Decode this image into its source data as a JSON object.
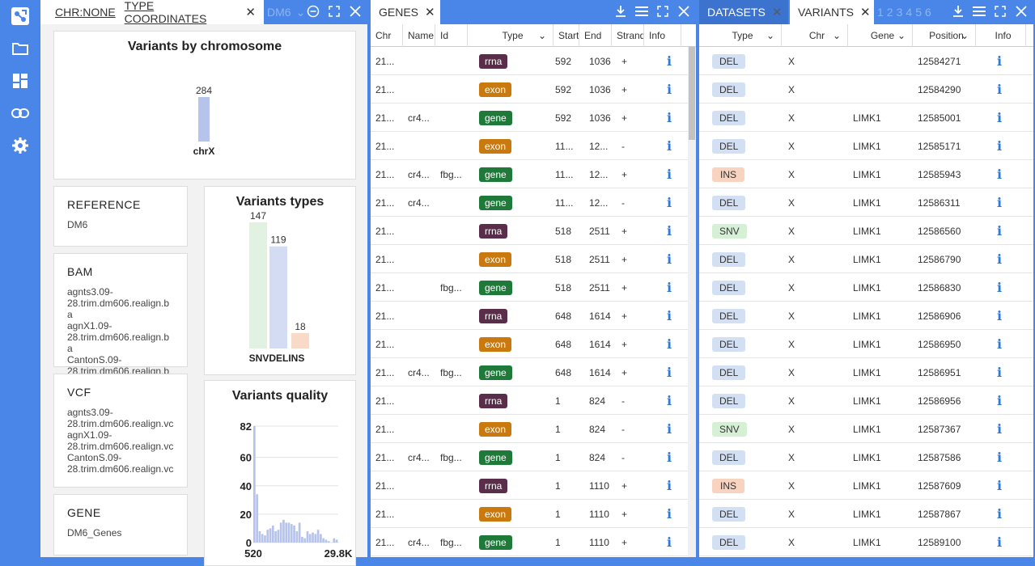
{
  "sidebar": {
    "items": [
      "logo-icon",
      "folder-icon",
      "dashboard-icon",
      "link-icon",
      "gear-icon"
    ]
  },
  "panel1": {
    "tab1_chr": "CHR:NONE",
    "tab1_coords": "TYPE COORDINATES",
    "tab2_label": "DM6",
    "chart_chrom": {
      "title": "Variants by chromosome"
    },
    "chart_types": {
      "title": "Variants types"
    },
    "chart_quality": {
      "title": "Variants quality"
    },
    "reference": {
      "title": "REFERENCE",
      "value": "DM6"
    },
    "bam": {
      "title": "BAM",
      "lines": [
        "agnts3.09-",
        "28.trim.dm606.realign.ba",
        "agnX1.09-",
        "28.trim.dm606.realign.ba",
        "CantonS.09-",
        "28.trim.dm606.realign.ba"
      ]
    },
    "vcf": {
      "title": "VCF",
      "lines": [
        "agnts3.09-",
        "28.trim.dm606.realign.vc",
        "agnX1.09-",
        "28.trim.dm606.realign.vc",
        "CantonS.09-",
        "28.trim.dm606.realign.vc"
      ]
    },
    "gene": {
      "title": "GENE",
      "value": "DM6_Genes"
    }
  },
  "chart_data": [
    {
      "type": "bar",
      "title": "Variants by chromosome",
      "categories": [
        "chrX"
      ],
      "values": [
        284
      ]
    },
    {
      "type": "bar",
      "title": "Variants types",
      "categories": [
        "SNV",
        "DEL",
        "INS"
      ],
      "values": [
        147,
        119,
        18
      ],
      "colors": [
        "#e2f2e2",
        "#d3dcf3",
        "#f9d9c7"
      ],
      "label_text": "SNVDELINS"
    },
    {
      "type": "bar",
      "title": "Variants quality",
      "x_range": [
        "520",
        "29.8K"
      ],
      "y_ticks": [
        0,
        20,
        40,
        60,
        80
      ],
      "ylim": [
        0,
        82
      ],
      "y_max_label": "82",
      "values": [
        82,
        34,
        8,
        6,
        5,
        9,
        10,
        12,
        8,
        9,
        14,
        16,
        14,
        14,
        13,
        12,
        8,
        14,
        4,
        3,
        8,
        6,
        7,
        6,
        9,
        6,
        3,
        2,
        1,
        0,
        3,
        2
      ]
    }
  ],
  "genes": {
    "tab": "GENES",
    "headers": [
      "Chr",
      "Name",
      "Id",
      "Type",
      "Start",
      "End",
      "Strand",
      "Info"
    ],
    "rows": [
      [
        "21...",
        "",
        "",
        "rrna",
        "592",
        "1036",
        "+"
      ],
      [
        "21...",
        "",
        "",
        "exon",
        "592",
        "1036",
        "+"
      ],
      [
        "21...",
        "cr4...",
        "",
        "gene",
        "592",
        "1036",
        "+"
      ],
      [
        "21...",
        "",
        "",
        "exon",
        "11...",
        "12...",
        "-"
      ],
      [
        "21...",
        "cr4...",
        "fbg...",
        "gene",
        "11...",
        "12...",
        "+"
      ],
      [
        "21...",
        "cr4...",
        "",
        "gene",
        "11...",
        "12...",
        "-"
      ],
      [
        "21...",
        "",
        "",
        "rrna",
        "518",
        "2511",
        "+"
      ],
      [
        "21...",
        "",
        "",
        "exon",
        "518",
        "2511",
        "+"
      ],
      [
        "21...",
        "",
        "fbg...",
        "gene",
        "518",
        "2511",
        "+"
      ],
      [
        "21...",
        "",
        "",
        "rrna",
        "648",
        "1614",
        "+"
      ],
      [
        "21...",
        "",
        "",
        "exon",
        "648",
        "1614",
        "+"
      ],
      [
        "21...",
        "cr4...",
        "fbg...",
        "gene",
        "648",
        "1614",
        "+"
      ],
      [
        "21...",
        "",
        "",
        "rrna",
        "1",
        "824",
        "-"
      ],
      [
        "21...",
        "",
        "",
        "exon",
        "1",
        "824",
        "-"
      ],
      [
        "21...",
        "cr4...",
        "fbg...",
        "gene",
        "1",
        "824",
        "-"
      ],
      [
        "21...",
        "",
        "",
        "rrna",
        "1",
        "1110",
        "+"
      ],
      [
        "21...",
        "",
        "",
        "exon",
        "1",
        "1110",
        "+"
      ],
      [
        "21...",
        "cr4...",
        "fbg...",
        "gene",
        "1",
        "1110",
        "+"
      ]
    ]
  },
  "variants": {
    "tab_datasets": "DATASETS",
    "tab_variants": "VARIANTS",
    "page_tabs": [
      "1",
      "2",
      "3",
      "4",
      "5",
      "6"
    ],
    "headers": [
      "Type",
      "Chr",
      "Gene",
      "Position",
      "Info"
    ],
    "rows": [
      [
        "DEL",
        "X",
        "",
        "12584271"
      ],
      [
        "DEL",
        "X",
        "",
        "12584290"
      ],
      [
        "DEL",
        "X",
        "LIMK1",
        "12585001"
      ],
      [
        "DEL",
        "X",
        "LIMK1",
        "12585171"
      ],
      [
        "INS",
        "X",
        "LIMK1",
        "12585943"
      ],
      [
        "DEL",
        "X",
        "LIMK1",
        "12586311"
      ],
      [
        "SNV",
        "X",
        "LIMK1",
        "12586560"
      ],
      [
        "DEL",
        "X",
        "LIMK1",
        "12586790"
      ],
      [
        "DEL",
        "X",
        "LIMK1",
        "12586830"
      ],
      [
        "DEL",
        "X",
        "LIMK1",
        "12586906"
      ],
      [
        "DEL",
        "X",
        "LIMK1",
        "12586950"
      ],
      [
        "DEL",
        "X",
        "LIMK1",
        "12586951"
      ],
      [
        "DEL",
        "X",
        "LIMK1",
        "12586956"
      ],
      [
        "SNV",
        "X",
        "LIMK1",
        "12587367"
      ],
      [
        "DEL",
        "X",
        "LIMK1",
        "12587586"
      ],
      [
        "INS",
        "X",
        "LIMK1",
        "12587609"
      ],
      [
        "DEL",
        "X",
        "LIMK1",
        "12587867"
      ],
      [
        "DEL",
        "X",
        "LIMK1",
        "12589100"
      ]
    ]
  },
  "info_glyph": "i",
  "colors": {
    "accent": "#4a86e8",
    "bar_chrom": "#b6c3ea",
    "bar_quality": "#b6c3ea"
  }
}
